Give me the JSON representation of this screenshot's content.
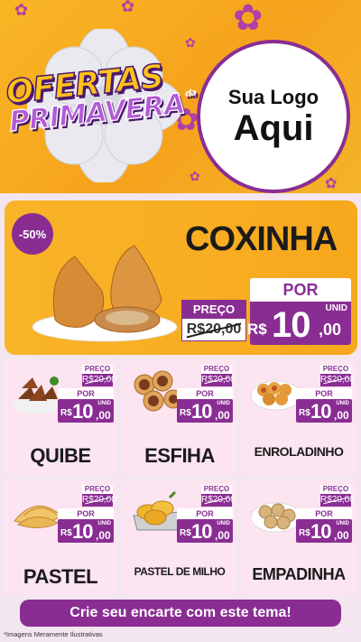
{
  "header": {
    "title_line1": "OFERTAS",
    "title_line2": "PRIMAVERA",
    "title_da": "da",
    "logo_line1": "Sua Logo",
    "logo_line2": "Aqui"
  },
  "featured": {
    "discount": "-50%",
    "name": "COXINHA",
    "old_label": "PREÇO",
    "old_price": "R$20,00",
    "new_label": "POR",
    "currency": "R$",
    "price_int": "10",
    "price_cents": ",00",
    "unit": "UNID"
  },
  "labels": {
    "old": "PREÇO",
    "new": "POR",
    "unit": "UNID",
    "currency": "R$"
  },
  "products": [
    {
      "name": "QUIBE",
      "old_price": "R$20,00",
      "price_int": "10",
      "price_cents": ",00",
      "food_icon": "kibbeh"
    },
    {
      "name": "ESFIHA",
      "old_price": "R$20,00",
      "price_int": "10",
      "price_cents": ",00",
      "food_icon": "esfiha"
    },
    {
      "name": "ENROLADINHO",
      "old_price": "R$20,00",
      "price_int": "10",
      "price_cents": ",00",
      "food_icon": "enroladinho"
    },
    {
      "name": "PASTEL",
      "old_price": "R$20,00",
      "price_int": "10",
      "price_cents": ",00",
      "food_icon": "pastel"
    },
    {
      "name": "PASTEL DE MILHO",
      "old_price": "R$20,00",
      "price_int": "10",
      "price_cents": ",00",
      "food_icon": "corn-pastel"
    },
    {
      "name": "EMPADINHA",
      "old_price": "R$20,00",
      "price_int": "10",
      "price_cents": ",00",
      "food_icon": "empadinha"
    }
  ],
  "cta": {
    "label": "Crie seu encarte com este tema!"
  },
  "disclaimer": "*Imagens Meramente Ilustrativas",
  "colors": {
    "purple": "#8a2d93",
    "orange": "#f7a81d",
    "card_pink": "#fce4f1",
    "background": "#f3e6f0"
  }
}
